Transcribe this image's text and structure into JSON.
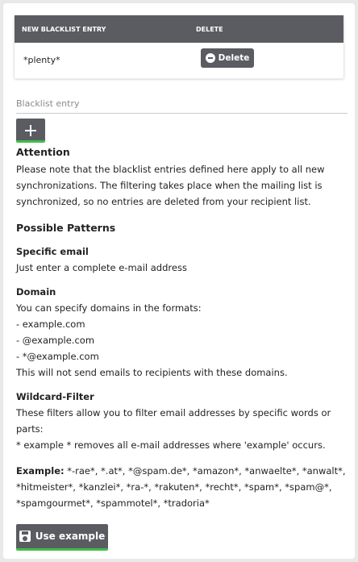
{
  "table": {
    "col_entry": "NEW BLACKLIST ENTRY",
    "col_delete": "DELETE",
    "rows": [
      {
        "entry": "*plenty*",
        "delete_label": "Delete"
      }
    ]
  },
  "input": {
    "label": "Blacklist entry"
  },
  "attention": {
    "title": "Attention",
    "text": "Please note that the blacklist entries defined here apply to all new synchronizations. The filtering takes place when the mailing list is synchronized, so no entries are deleted from your recipient list."
  },
  "patterns": {
    "title": "Possible Patterns",
    "specific": {
      "title": "Specific email",
      "text": "Just enter a complete e-mail address"
    },
    "domain": {
      "title": "Domain",
      "intro": "You can specify domains in the formats:",
      "items": [
        "- example.com",
        "- @example.com",
        "- *@example.com"
      ],
      "outro": "This will not send emails to recipients with these domains."
    },
    "wildcard": {
      "title": "Wildcard-Filter",
      "text": "These filters allow you to filter email addresses by specific words or parts:",
      "example_line": "* example * removes all e-mail addresses where 'example' occurs."
    },
    "example": {
      "label": "Example:",
      "value": " *-rae*, *.at*, *@spam.de*, *amazon*, *anwaelte*, *anwalt*, *hitmeister*, *kanzlei*, *ra-*, *rakuten*, *recht*, *spam*, *spam@*, *spamgourmet*, *spammotel*, *tradoria*"
    }
  },
  "buttons": {
    "use_example": "Use example"
  },
  "colors": {
    "header_bg": "#5b5c61",
    "accent_green": "#3fbf4a",
    "page_bg": "#e9e9e9"
  },
  "icons": {
    "delete": "minus-circle-icon",
    "add": "plus-icon",
    "save": "save-icon"
  }
}
